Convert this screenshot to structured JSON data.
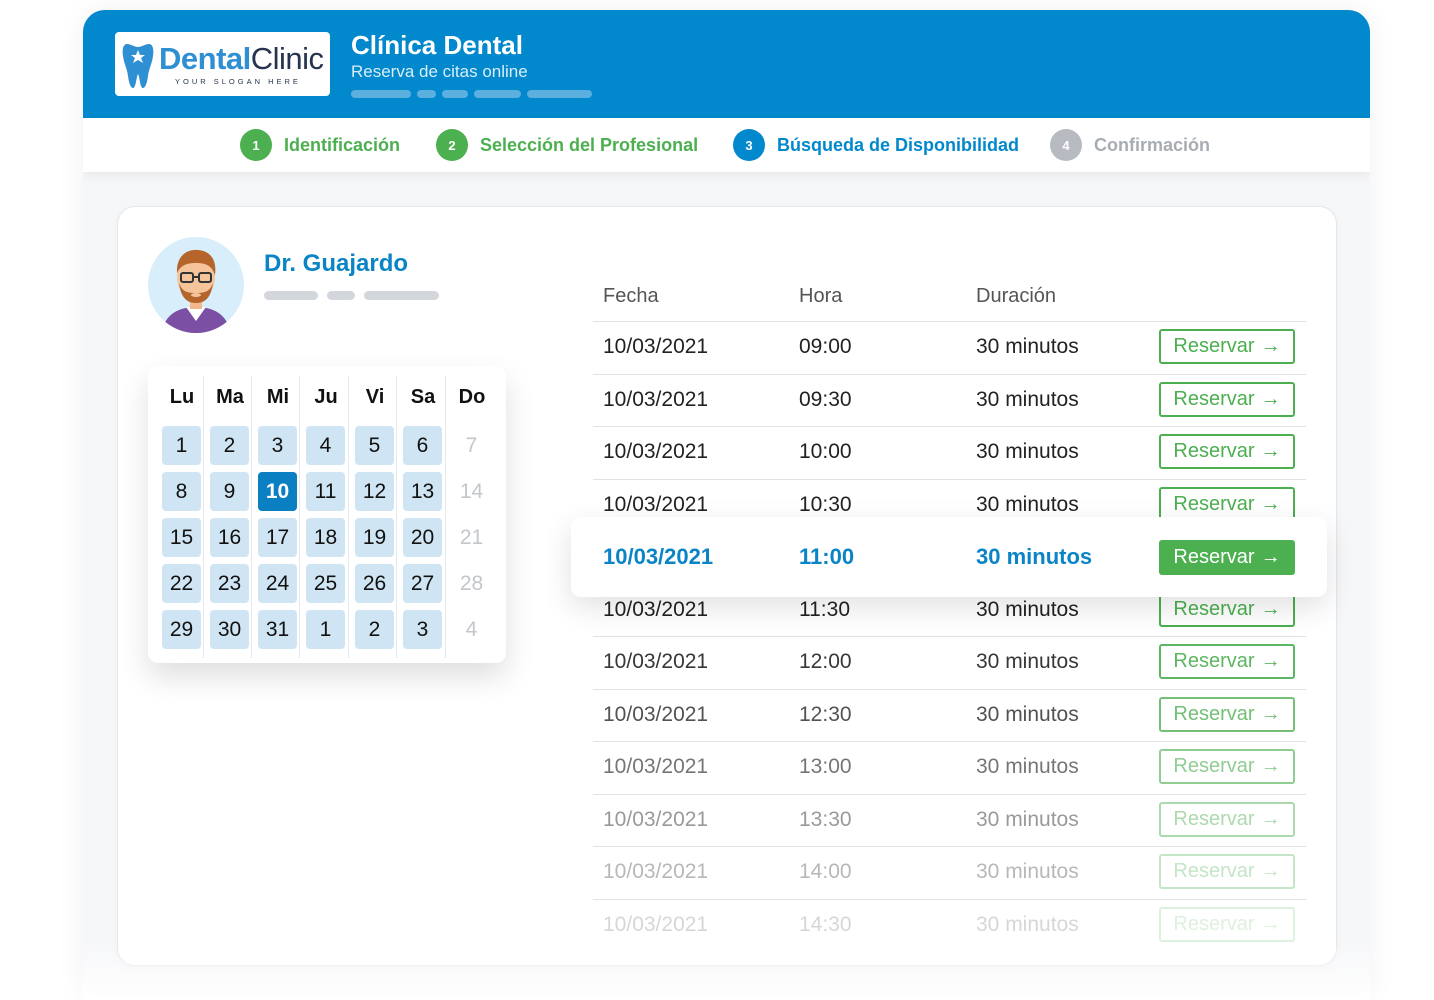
{
  "header": {
    "logo_brand_part1": "Dental",
    "logo_brand_part2": "Clinic",
    "logo_slogan": "YOUR SLOGAN HERE",
    "title": "Clínica Dental",
    "subtitle": "Reserva de citas online",
    "color": "#0288cc"
  },
  "steps": [
    {
      "number": "1",
      "label": "Identificación",
      "state": "done"
    },
    {
      "number": "2",
      "label": "Selección del Profesional",
      "state": "done"
    },
    {
      "number": "3",
      "label": "Búsqueda de Disponibilidad",
      "state": "active"
    },
    {
      "number": "4",
      "label": "Confirmación",
      "state": "pending"
    }
  ],
  "doctor": {
    "name": "Dr. Guajardo"
  },
  "calendar": {
    "weekdays": [
      "Lu",
      "Ma",
      "Mi",
      "Ju",
      "Vi",
      "Sa",
      "Do"
    ],
    "weeks": [
      [
        "1",
        "2",
        "3",
        "4",
        "5",
        "6",
        "7"
      ],
      [
        "8",
        "9",
        "10",
        "11",
        "12",
        "13",
        "14"
      ],
      [
        "15",
        "16",
        "17",
        "18",
        "19",
        "20",
        "21"
      ],
      [
        "22",
        "23",
        "24",
        "25",
        "26",
        "27",
        "28"
      ],
      [
        "29",
        "30",
        "31",
        "1",
        "2",
        "3",
        "4"
      ]
    ],
    "selected_day": "10"
  },
  "slots": {
    "headers": {
      "date": "Fecha",
      "time": "Hora",
      "duration": "Duración"
    },
    "button_label": "Reservar",
    "rows": [
      {
        "date": "10/03/2021",
        "time": "09:00",
        "duration": "30 minutos"
      },
      {
        "date": "10/03/2021",
        "time": "09:30",
        "duration": "30 minutos"
      },
      {
        "date": "10/03/2021",
        "time": "10:00",
        "duration": "30 minutos"
      },
      {
        "date": "10/03/2021",
        "time": "10:30",
        "duration": "30 minutos"
      },
      {
        "date": "10/03/2021",
        "time": "11:00",
        "duration": "30 minutos",
        "highlighted": true
      },
      {
        "date": "10/03/2021",
        "time": "11:30",
        "duration": "30 minutos"
      },
      {
        "date": "10/03/2021",
        "time": "12:00",
        "duration": "30 minutos"
      },
      {
        "date": "10/03/2021",
        "time": "12:30",
        "duration": "30 minutos"
      },
      {
        "date": "10/03/2021",
        "time": "13:00",
        "duration": "30 minutos"
      },
      {
        "date": "10/03/2021",
        "time": "13:30",
        "duration": "30 minutos"
      },
      {
        "date": "10/03/2021",
        "time": "14:00",
        "duration": "30 minutos"
      },
      {
        "date": "10/03/2021",
        "time": "14:30",
        "duration": "30 minutos"
      }
    ]
  },
  "colors": {
    "accent": "#0288cc",
    "success": "#4caf50",
    "pending": "#b7bbc1"
  }
}
